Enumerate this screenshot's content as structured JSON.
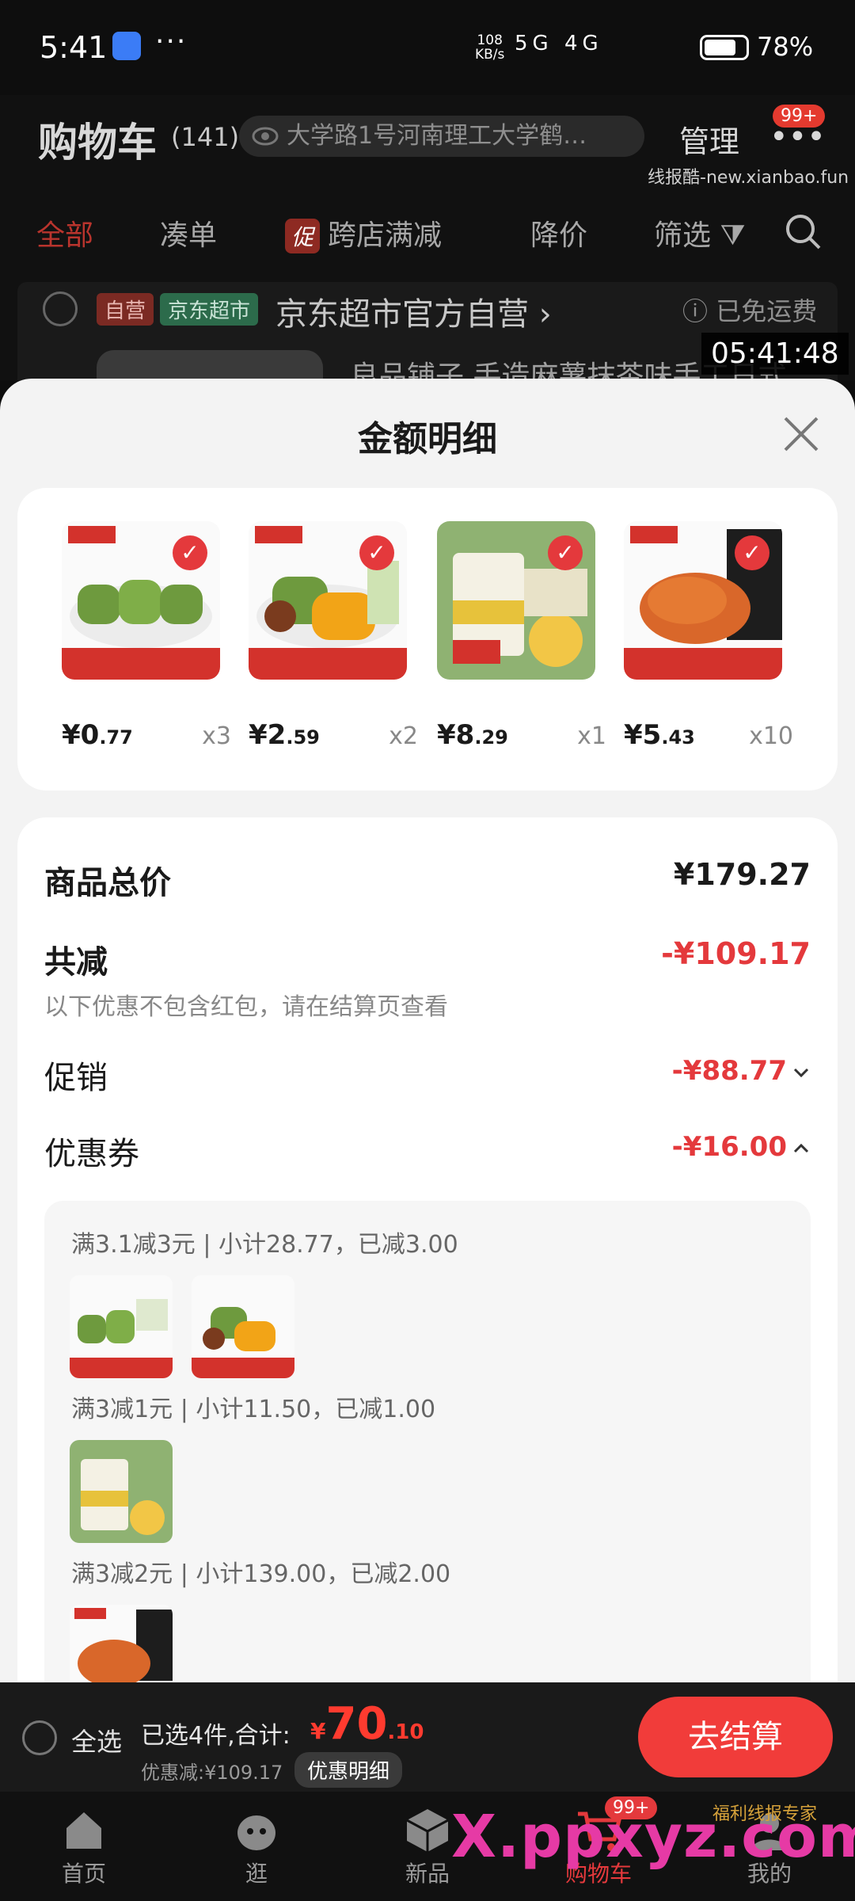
{
  "status_bar": {
    "time": "5:41",
    "dots": "···",
    "speed_value": "108",
    "speed_unit": "KB/s",
    "signal_icons": "5G 4G",
    "battery_pct": "78%",
    "battery_level": 0.78
  },
  "header": {
    "title": "购物车",
    "count": "(141)",
    "address": "大学路1号河南理工大学鹤…",
    "manage_label": "管理",
    "badge": "99+",
    "watermark": "线报酷-new.xianbao.fun"
  },
  "tabs": [
    {
      "label": "全部",
      "active": true
    },
    {
      "label": "凑单",
      "active": false
    },
    {
      "promo_tag": "促",
      "label": "跨店满减",
      "active": false
    },
    {
      "label": "降价",
      "active": false
    },
    {
      "label": "筛选",
      "active": false
    }
  ],
  "store": {
    "tag_self": "自营",
    "tag_jd": "京东超市",
    "name": "京东超市官方自营",
    "free_shipping": "已免运费",
    "item_name": "良品铺子 手造麻薯抹茶味手工日式"
  },
  "timestamp": "05:41:48",
  "sheet": {
    "title": "金额明细",
    "products": [
      {
        "price_int": "¥0",
        "price_dec": ".77",
        "qty": "x3"
      },
      {
        "price_int": "¥2",
        "price_dec": ".59",
        "qty": "x2"
      },
      {
        "price_int": "¥8",
        "price_dec": ".29",
        "qty": "x1"
      },
      {
        "price_int": "¥5",
        "price_dec": ".43",
        "qty": "x10"
      }
    ],
    "total_label": "商品总价",
    "total_value": "¥179.27",
    "reduce_label": "共减",
    "reduce_value": "-¥109.17",
    "reduce_note": "以下优惠不包含红包，请在结算页查看",
    "promo_label": "促销",
    "promo_value": "-¥88.77",
    "coupon_label": "优惠券",
    "coupon_value": "-¥16.00",
    "coupon_rules": [
      "满3.1减3元 | 小计28.77，已减3.00",
      "满3减1元 | 小计11.50，已减1.00",
      "满3减2元 | 小计139.00，已减2.00"
    ]
  },
  "checkout": {
    "select_all": "全选",
    "selected_text": "已选4件,合计:",
    "total_currency": "¥",
    "total_int": "70",
    "total_dec": ".10",
    "discount_text": "优惠减:¥109.17",
    "detail_btn": "优惠明细",
    "go_btn": "去结算"
  },
  "nav": {
    "items": [
      "首页",
      "逛",
      "新品",
      "购物车",
      "我的"
    ],
    "badge": "99+",
    "watermark": "X.ppxyz.com",
    "watermark_small": "福利线报专家"
  },
  "colors": {
    "accent": "#e4393c",
    "sheet_bg": "#f3f3f3"
  }
}
